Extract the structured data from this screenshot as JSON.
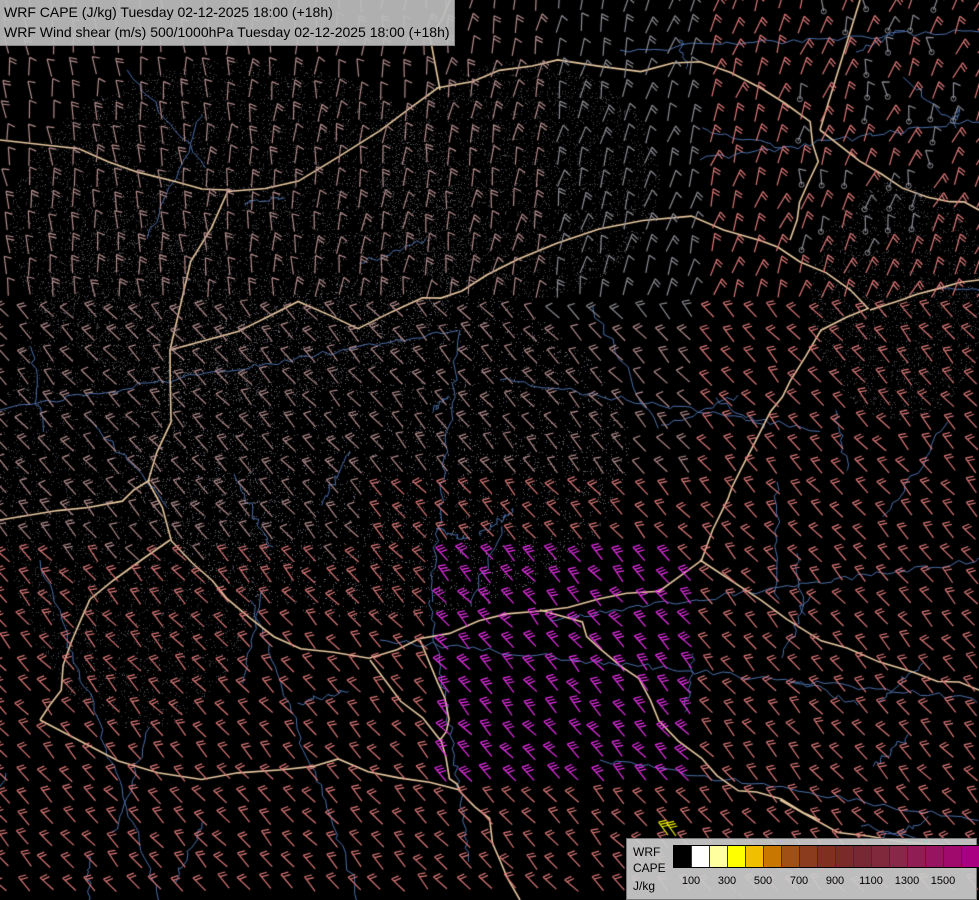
{
  "titles": {
    "line1": "WRF CAPE (J/kg) Tuesday 02-12-2025 18:00 (+18h)",
    "line2": "WRF Wind shear (m/s) 500/1000hPa Tuesday 02-12-2025 18:00 (+18h)"
  },
  "legend": {
    "model": "WRF",
    "field": "CAPE",
    "unit": "J/kg",
    "tick_labels": [
      "100",
      "300",
      "500",
      "700",
      "900",
      "1100",
      "1300",
      "1500"
    ],
    "colors": [
      "#000000",
      "#ffffff",
      "#ffffa0",
      "#ffff00",
      "#f0c000",
      "#c87800",
      "#a05014",
      "#8c3c1e",
      "#80301e",
      "#7a2a28",
      "#782832",
      "#80283c",
      "#882848",
      "#901e54",
      "#981460",
      "#a00a6c",
      "#a80080"
    ]
  },
  "map": {
    "background": "#000000",
    "border_color": "#e8c8a0",
    "river_color": "#4a6ea8",
    "barb_colors": {
      "low_shear": "#8c8c94",
      "medium_shear": "#b48c8c",
      "high_shear": "#dc7878",
      "very_high_shear": "#e830e8",
      "extreme_shear": "#f0f000"
    }
  }
}
